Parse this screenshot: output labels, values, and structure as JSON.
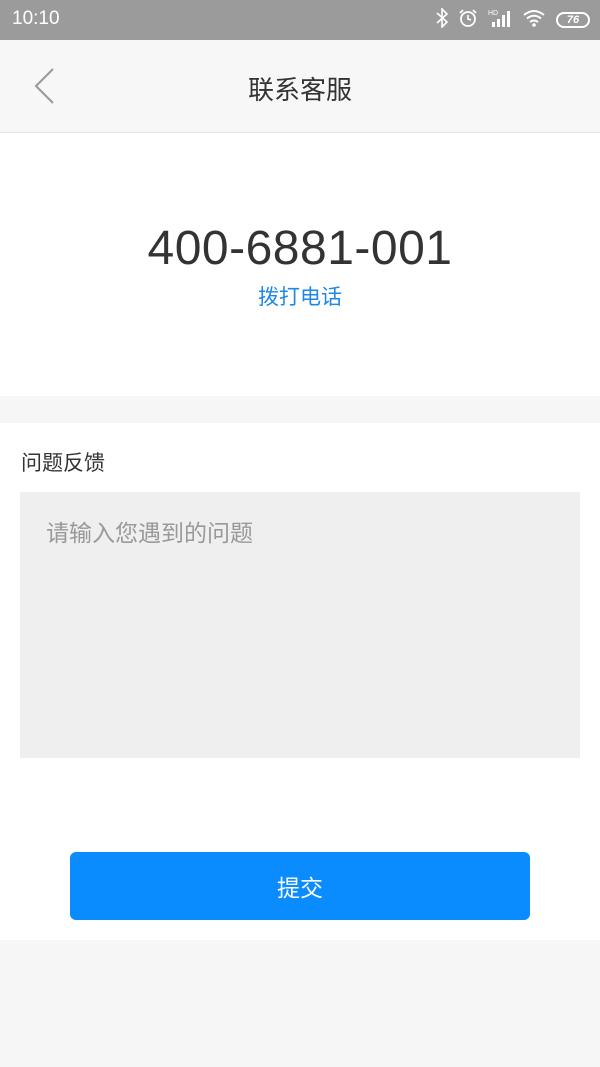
{
  "status_bar": {
    "time": "10:10",
    "battery_level": "76",
    "icons": [
      "bluetooth-icon",
      "alarm-icon",
      "signal-icon",
      "wifi-icon",
      "battery-icon"
    ]
  },
  "header": {
    "title": "联系客服",
    "back_icon": "chevron-left-icon"
  },
  "contact": {
    "phone_number": "400-6881-001",
    "dial_label": "拨打电话"
  },
  "feedback": {
    "label": "问题反馈",
    "placeholder": "请输入您遇到的问题",
    "value": ""
  },
  "actions": {
    "submit_label": "提交"
  },
  "colors": {
    "accent": "#0a8cff",
    "link": "#1e88e5",
    "status_bar": "#9b9b9b",
    "text": "#333333"
  }
}
